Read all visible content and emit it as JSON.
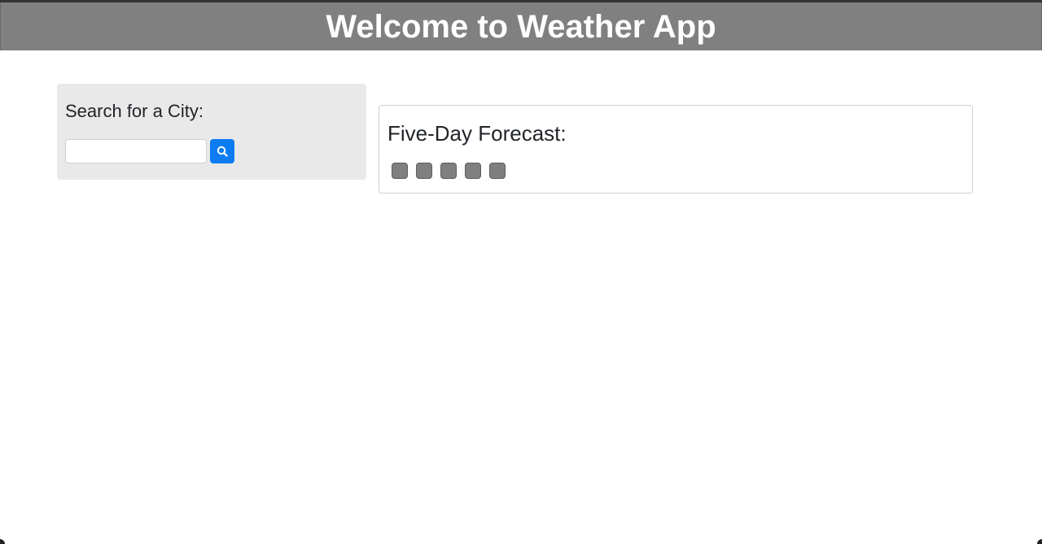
{
  "header": {
    "title": "Welcome to Weather App"
  },
  "search": {
    "title": "Search for a City:",
    "input_value": "",
    "placeholder": "",
    "button_icon": "search-icon"
  },
  "forecast": {
    "title": "Five-Day Forecast:",
    "days": [
      "",
      "",
      "",
      "",
      ""
    ]
  },
  "colors": {
    "header_bg": "#808080",
    "search_panel_bg": "#e9e9e9",
    "search_button_bg": "#0d7cf2",
    "forecast_day_bg": "#7f7f7f"
  }
}
